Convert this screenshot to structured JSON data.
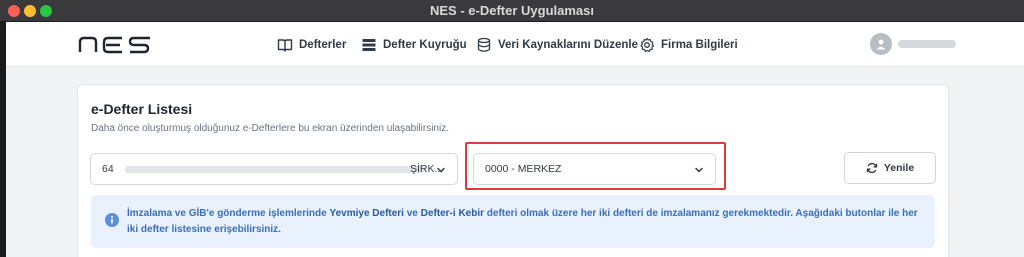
{
  "window": {
    "title": "NES - e-Defter Uygulaması"
  },
  "nav": {
    "items": [
      {
        "label": "Defterler",
        "icon": "book-icon"
      },
      {
        "label": "Defter Kuyruğu",
        "icon": "queue-icon"
      },
      {
        "label": "Veri Kaynaklarını Düzenle",
        "icon": "database-icon"
      },
      {
        "label": "Firma Bilgileri",
        "icon": "gear-icon"
      }
    ]
  },
  "card": {
    "title": "e-Defter Listesi",
    "subtitle": "Daha önce oluşturmuş olduğunuz e-Defterlere bu ekran üzerinden ulaşabilirsiniz."
  },
  "company_select": {
    "prefix": "64",
    "suffix": "ŞİRK..."
  },
  "branch_select": {
    "value": "0000 - MERKEZ"
  },
  "refresh_button": {
    "label": "Yenile"
  },
  "alert": {
    "part1": "İmzalama ve GİB'e gönderme işlemlerinde ",
    "bold1": "Yevmiye Defteri",
    "part2": " ve ",
    "bold2": "Defter-i Kebir",
    "part3": " defteri olmak üzere her iki defteri de imzalamanız gerekmektedir. Aşağıdaki butonlar ile her iki defter listesine erişebilirsiniz."
  },
  "colors": {
    "accent": "#3a6fb8",
    "highlight": "#e03a3a",
    "alert_bg": "#e8f1fc"
  }
}
